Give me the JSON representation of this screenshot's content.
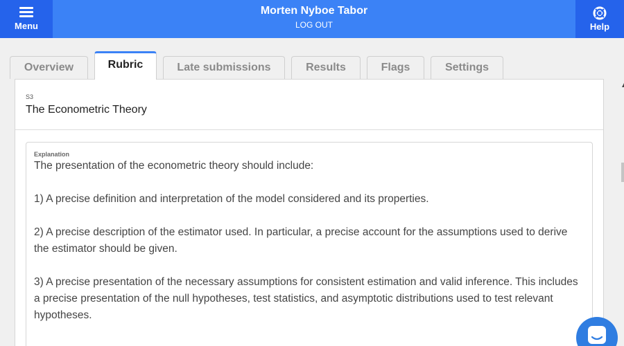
{
  "header": {
    "menu_label": "Menu",
    "user_name": "Morten Nyboe Tabor",
    "logout_label": "LOG OUT",
    "help_label": "Help",
    "bar_color": "#3b82f6",
    "button_color": "#2563eb"
  },
  "tabs": [
    {
      "label": "Overview",
      "active": false
    },
    {
      "label": "Rubric",
      "active": true
    },
    {
      "label": "Late submissions",
      "active": false
    },
    {
      "label": "Results",
      "active": false
    },
    {
      "label": "Flags",
      "active": false
    },
    {
      "label": "Settings",
      "active": false
    }
  ],
  "section": {
    "number": "S3",
    "title": "The Econometric Theory",
    "explanation_label": "Explanation",
    "explanation_text": "The presentation of the econometric theory should include:\n\n1) A precise definition and interpretation of the model considered and its properties.\n\n2) A precise description of the estimator used. In particular, a precise account for the assumptions used to derive the estimator should be given.\n\n3) A precise presentation of the necessary assumptions for consistent estimation and valid inference. This includes a precise presentation of the null hypotheses, test statistics, and asymptotic distributions used to test relevant hypotheses."
  },
  "icons": {
    "menu": "hamburger-icon",
    "help": "lifebuoy-icon",
    "chat": "chat-icon"
  }
}
